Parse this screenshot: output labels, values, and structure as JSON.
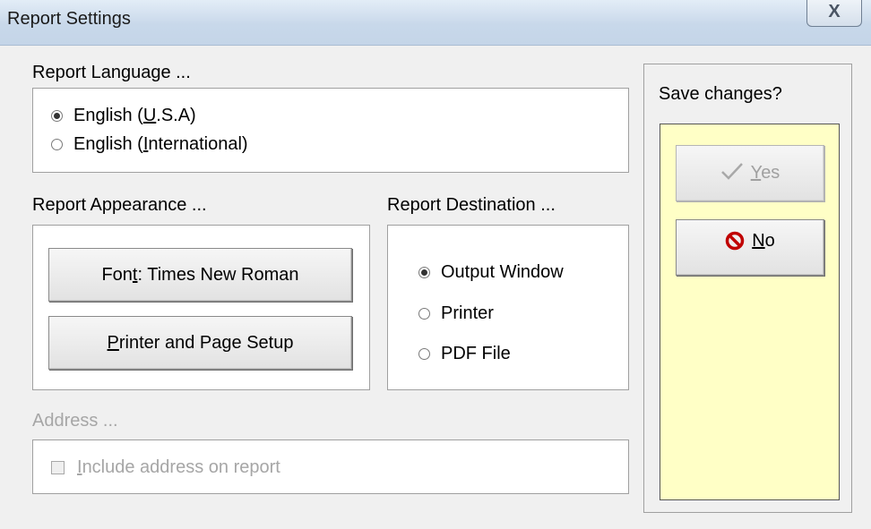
{
  "window": {
    "title": "Report Settings",
    "close_glyph": "X"
  },
  "language": {
    "label": "Report Language ...",
    "options": [
      {
        "pre": "English (",
        "accel": "U",
        "post": ".S.A)",
        "checked": true
      },
      {
        "pre": "English (",
        "accel": "I",
        "post": "nternational)",
        "checked": false
      }
    ]
  },
  "appearance": {
    "label": "Report Appearance ...",
    "font_button": {
      "pre": "Fon",
      "accel": "t",
      "post": ": Times New Roman"
    },
    "page_button": {
      "pre": "",
      "accel": "P",
      "post": "rinter and Page Setup"
    }
  },
  "destination": {
    "label": "Report Destination ...",
    "options": [
      {
        "label": "Output Window",
        "checked": true
      },
      {
        "label": "Printer",
        "checked": false
      },
      {
        "label": "PDF File",
        "checked": false
      }
    ]
  },
  "address": {
    "label": "Address ...",
    "checkbox": {
      "accel": "I",
      "post": "nclude address on report",
      "checked": false,
      "disabled": true
    }
  },
  "save": {
    "question": "Save changes?",
    "yes": {
      "accel": "Y",
      "post": "es",
      "icon": "checkmark-icon",
      "disabled": true
    },
    "no": {
      "accel": "N",
      "post": "o",
      "icon": "no-entry-icon",
      "icon_color": "#c00000"
    }
  },
  "colors": {
    "save_panel_bg": "#ffffc6",
    "disabled_text": "#a6a6a6"
  }
}
